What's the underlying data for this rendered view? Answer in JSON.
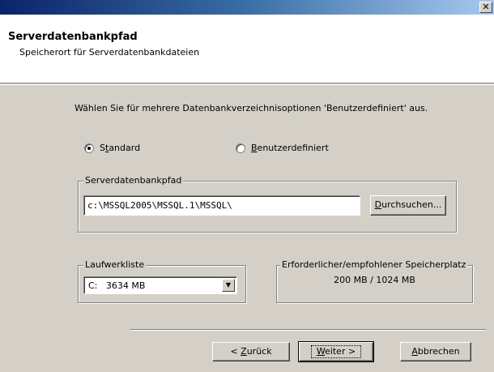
{
  "window": {
    "close_glyph": "✕"
  },
  "header": {
    "title": "Serverdatenbankpfad",
    "subtitle": "Speicherort für Serverdatenbankdateien"
  },
  "instruction": "Wählen Sie für mehrere Datenbankverzeichnisoptionen 'Benutzerdefiniert' aus.",
  "options": {
    "standard": {
      "label_prefix": "S",
      "label_key": "t",
      "label_rest": "andard",
      "checked": true
    },
    "custom": {
      "label_prefix": "",
      "label_key": "B",
      "label_rest": "enutzerdefiniert",
      "checked": false
    }
  },
  "db_path_group": {
    "legend": "Serverdatenbankpfad",
    "value": "c:\\MSSQL2005\\MSSQL.1\\MSSQL\\",
    "browse_key": "D",
    "browse_rest": "urchsuchen..."
  },
  "drive_group": {
    "legend": "Laufwerkliste",
    "selected": "C:   3634 MB",
    "arrow_icon": "▼"
  },
  "space_group": {
    "legend": "Erforderlicher/empfohlener Speicherplatz",
    "value": "200 MB / 1024 MB"
  },
  "buttons": {
    "back_prefix": "< ",
    "back_key": "Z",
    "back_rest": "urück",
    "next_key": "W",
    "next_rest": "eiter >",
    "cancel_key": "A",
    "cancel_rest": "bbrechen"
  }
}
